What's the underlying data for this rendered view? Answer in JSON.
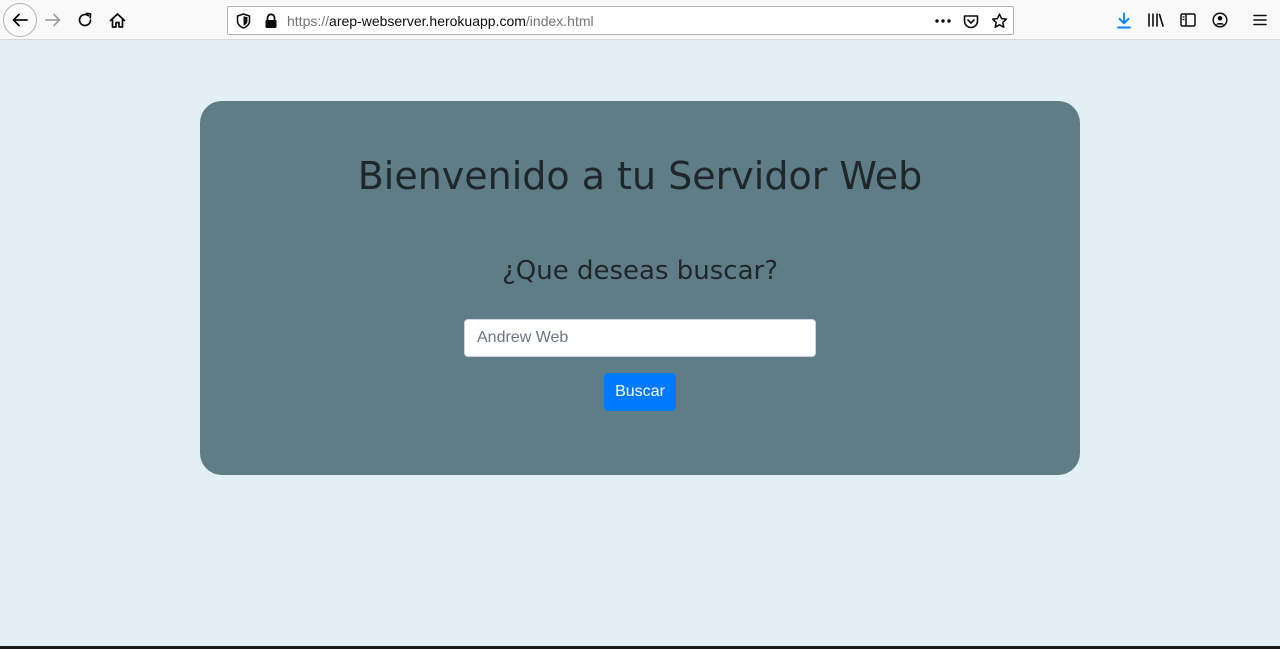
{
  "browser": {
    "url": {
      "scheme": "https://",
      "host": "arep-webserver.herokuapp.com",
      "path": "/index.html"
    },
    "accent_color": "#0a84ff"
  },
  "page": {
    "background_color": "#e2f0f5",
    "card_color": "#5f7d87",
    "title": "Bienvenido a tu Servidor Web",
    "subtitle": "¿Que deseas buscar?",
    "search": {
      "placeholder": "Andrew Web",
      "value": ""
    },
    "button": {
      "label": "Buscar",
      "color": "#007bff"
    }
  }
}
